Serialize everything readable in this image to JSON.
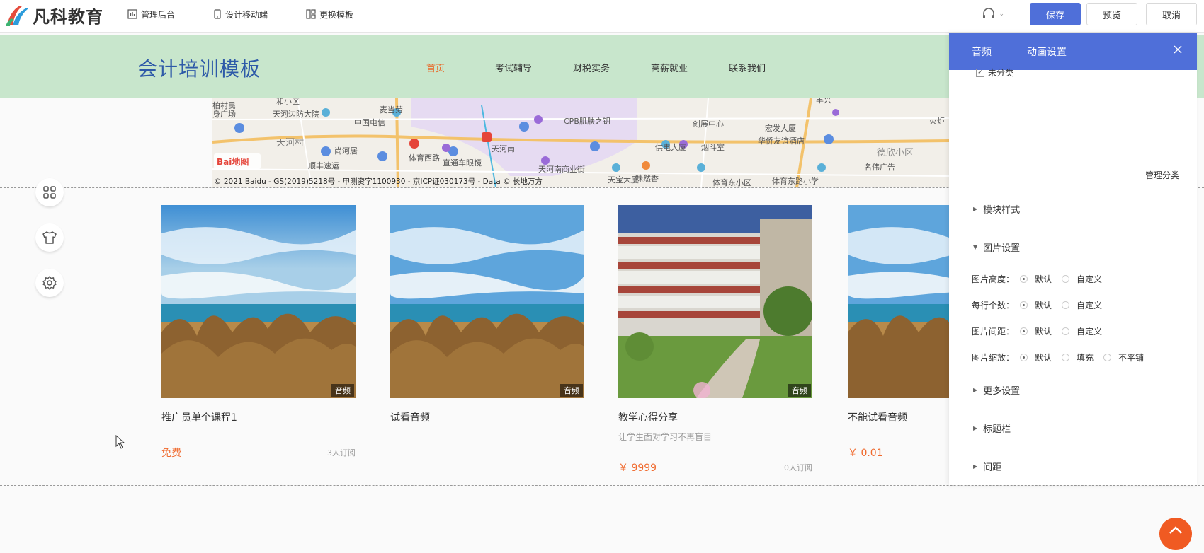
{
  "app": {
    "brand": "凡科教育",
    "toolbar": [
      {
        "label": "管理后台",
        "icon": "bar-chart-icon"
      },
      {
        "label": "设计移动端",
        "icon": "mobile-icon"
      },
      {
        "label": "更换模板",
        "icon": "template-icon"
      }
    ],
    "actions": {
      "save": "保存",
      "preview": "预览",
      "cancel": "取消"
    }
  },
  "site": {
    "title": "会计培训模板",
    "nav": [
      {
        "label": "首页",
        "active": true
      },
      {
        "label": "考试辅导",
        "active": false
      },
      {
        "label": "财税实务",
        "active": false
      },
      {
        "label": "高薪就业",
        "active": false
      },
      {
        "label": "联系我们",
        "active": false
      }
    ]
  },
  "map": {
    "logo": "Bai地图",
    "copyright": "© 2021 Baidu - GS(2019)5218号 - 甲测资字1100930 - 京ICP证030173号 - Data © 长地万方",
    "labels": [
      {
        "text": "和小区"
      },
      {
        "text": "天河边防大院"
      },
      {
        "text": "麦当劳"
      },
      {
        "text": "中国电信"
      },
      {
        "text": "天河村"
      },
      {
        "text": "尚河居"
      },
      {
        "text": "顺丰速运"
      },
      {
        "text": "体育西路"
      },
      {
        "text": "直通车眼镜"
      },
      {
        "text": "天河南"
      },
      {
        "text": "天河南商业街"
      },
      {
        "text": "CPB肌肤之钥"
      },
      {
        "text": "创展中心"
      },
      {
        "text": "宏发大厦"
      },
      {
        "text": "华侨友谊酒店"
      },
      {
        "text": "供电大厦"
      },
      {
        "text": "烟斗室"
      },
      {
        "text": "味然香"
      },
      {
        "text": "天宝大厦"
      },
      {
        "text": "体育东小区"
      },
      {
        "text": "体育东路小学"
      },
      {
        "text": "德欣小区"
      },
      {
        "text": "名伟广告"
      },
      {
        "text": "羊兴"
      },
      {
        "text": "火炬"
      },
      {
        "text": "身广场"
      },
      {
        "text": "柏村民"
      }
    ]
  },
  "side_tools": [
    {
      "name": "grid-icon"
    },
    {
      "name": "shirt-icon"
    },
    {
      "name": "gear-icon"
    }
  ],
  "courses": [
    {
      "title": "推广员单个课程1",
      "subtitle": "",
      "price": "免费",
      "subscribers": "3人订阅",
      "tag": "音频",
      "image": "beach-grass"
    },
    {
      "title": "试看音频",
      "subtitle": "",
      "price": "",
      "subscribers": "",
      "tag": "音频",
      "image": "beach-grass"
    },
    {
      "title": "教学心得分享",
      "subtitle": "让学生面对学习不再盲目",
      "price": "￥ 9999",
      "subscribers": "0人订阅",
      "tag": "音频",
      "image": "campus-building"
    },
    {
      "title": "不能试看音频",
      "subtitle": "",
      "price": "￥ 0.01",
      "subscribers": "",
      "tag": "",
      "image": "beach-grass"
    }
  ],
  "panel": {
    "tabs": [
      "音频",
      "动画设置"
    ],
    "category_option": "未分类",
    "manage_link": "管理分类",
    "sections": {
      "module_style": "模块样式",
      "image_settings": "图片设置",
      "more_settings": "更多设置",
      "title_bar": "标题栏",
      "spacing": "间距"
    },
    "image_rows": [
      {
        "label": "图片高度：",
        "options": [
          "默认",
          "自定义"
        ],
        "selected": 0
      },
      {
        "label": "每行个数：",
        "options": [
          "默认",
          "自定义"
        ],
        "selected": 0
      },
      {
        "label": "图片间距：",
        "options": [
          "默认",
          "自定义"
        ],
        "selected": 0
      },
      {
        "label": "图片缩放：",
        "options": [
          "默认",
          "填充",
          "不平铺"
        ],
        "selected": 0
      }
    ]
  },
  "colors": {
    "accent": "#4f6fd9",
    "price": "#f06a2e",
    "header_bg": "#c8e6cc",
    "title": "#2e5aa8"
  }
}
